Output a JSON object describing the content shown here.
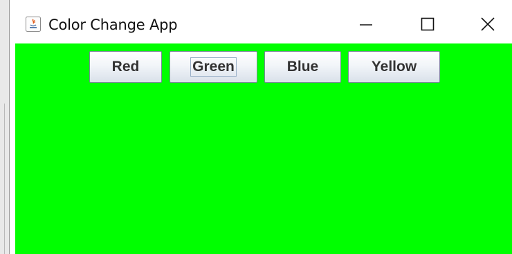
{
  "window": {
    "title": "Color Change App",
    "background_color": "#00ff00"
  },
  "title_controls": {
    "minimize_icon": "minimize-icon",
    "maximize_icon": "maximize-icon",
    "close_icon": "close-icon"
  },
  "buttons": [
    {
      "label": "Red",
      "focused": false
    },
    {
      "label": "Green",
      "focused": true
    },
    {
      "label": "Blue",
      "focused": false
    },
    {
      "label": "Yellow",
      "focused": false
    }
  ]
}
